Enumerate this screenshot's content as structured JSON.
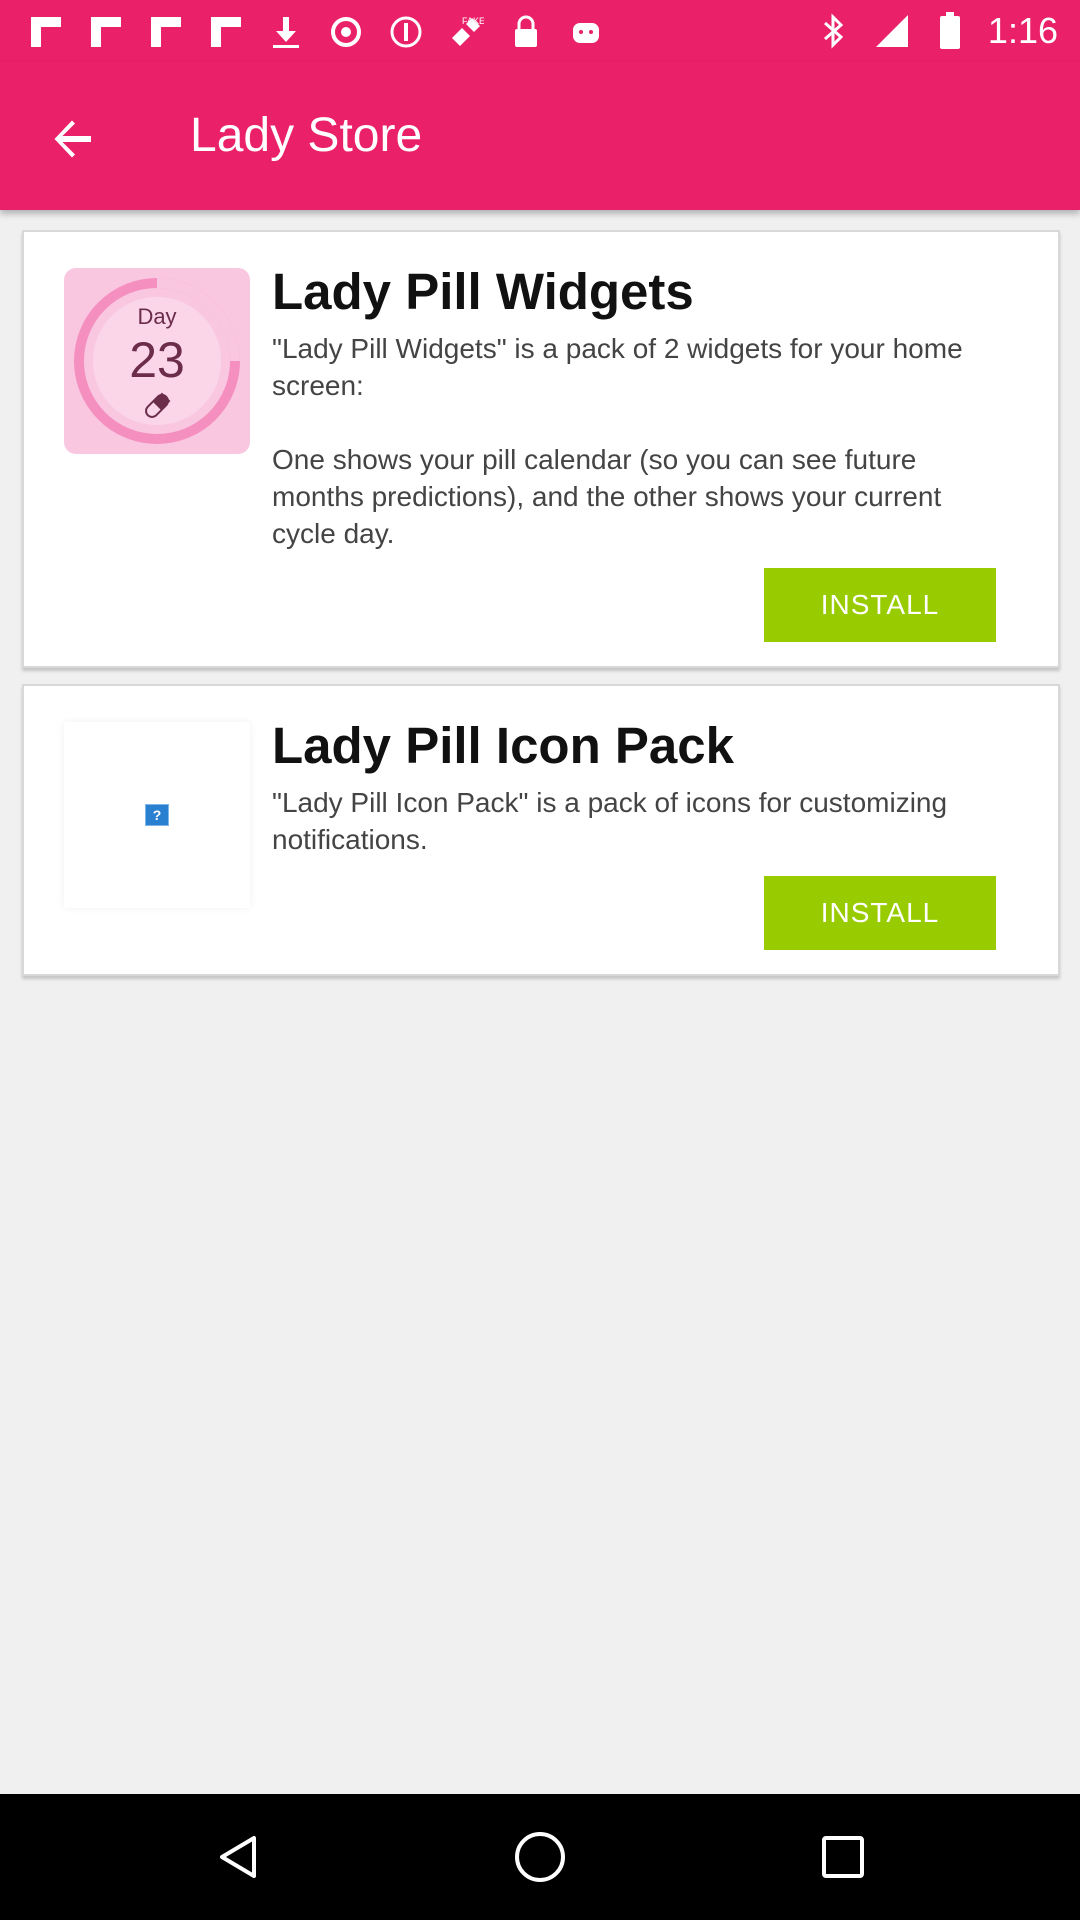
{
  "status_bar": {
    "time": "1:16",
    "icons_left": [
      "flipboard-icon",
      "flipboard-icon",
      "flipboard-icon",
      "flipboard-icon",
      "download-icon",
      "record-icon",
      "block-icon",
      "fake-gps-icon",
      "lock-icon",
      "android-icon"
    ],
    "icons_right": [
      "bluetooth-icon",
      "signal-icon",
      "battery-icon"
    ]
  },
  "app_bar": {
    "title": "Lady Store",
    "back_icon": "arrow-back-icon"
  },
  "products": [
    {
      "title": "Lady Pill Widgets",
      "description": "\"Lady Pill Widgets\" is a pack of 2 widgets for your home screen:\n\nOne shows your pill calendar (so you can see future months predictions), and the other shows your current cycle day.",
      "install_label": "INSTALL",
      "thumb": {
        "day_label": "Day",
        "day_number": "23"
      }
    },
    {
      "title": "Lady Pill Icon Pack",
      "description": "\"Lady Pill Icon Pack\" is a pack of icons for customizing notifications.",
      "install_label": "INSTALL",
      "thumb": {
        "placeholder": "?"
      }
    }
  ],
  "colors": {
    "primary": "#ea2068",
    "install": "#99cc00",
    "background": "#f0f0f0",
    "thumb_pink": "#f9c8e0"
  },
  "nav_bar": {
    "buttons": [
      "nav-back-icon",
      "nav-home-icon",
      "nav-recents-icon"
    ]
  }
}
